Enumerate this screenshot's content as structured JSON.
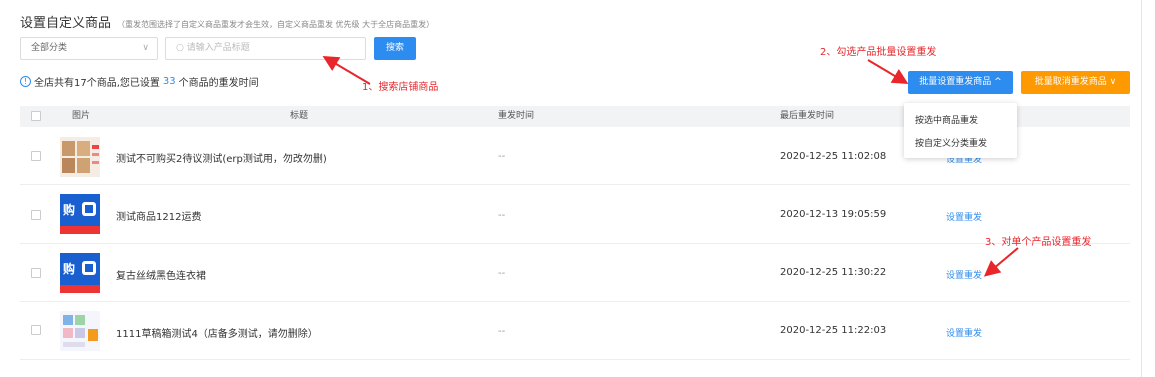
{
  "header": {
    "title": "设置自定义商品",
    "hint": "（重发范围选择了自定义商品重发才会生效，自定义商品重发 优先级 大于全店商品重发）"
  },
  "filters": {
    "category_value": "全部分类",
    "search_placeholder": "请输入产品标题",
    "search_button": "搜索"
  },
  "info": {
    "prefix": "全店共有17个商品,您已设置",
    "count": "33",
    "suffix": "个商品的重发时间"
  },
  "actions": {
    "batch_label": "批量设置重发商品 ^",
    "cancel_label": "批量取消重发商品 ∨"
  },
  "dropdown": {
    "items": [
      "按选中商品重发",
      "按自定义分类重发"
    ]
  },
  "table": {
    "columns": [
      "图片",
      "标题",
      "重发时间",
      "最后重发时间"
    ],
    "rows": [
      {
        "title": "测试不可购买2待议测试(erp测试用，勿改勿删)",
        "resend_time": "--",
        "last_time": "2020-12-25 11:02:08",
        "action": "设置重发"
      },
      {
        "title": "测试商品1212运费",
        "resend_time": "--",
        "last_time": "2020-12-13 19:05:59",
        "action": "设置重发"
      },
      {
        "title": "复古丝绒黑色连衣裙",
        "resend_time": "--",
        "last_time": "2020-12-25 11:30:22",
        "action": "设置重发"
      },
      {
        "title": "1111草稿箱测试4（店备多测试，请勿删除）",
        "resend_time": "--",
        "last_time": "2020-12-25 11:22:03",
        "action": "设置重发"
      }
    ]
  },
  "annotations": {
    "a1": "1、搜索店铺商品",
    "a2": "2、勾选产品批量设置重发",
    "a3": "3、对单个产品设置重发"
  },
  "colors": {
    "primary": "#2d8cf0",
    "orange": "#ff9900",
    "annotation": "#e8262b"
  }
}
